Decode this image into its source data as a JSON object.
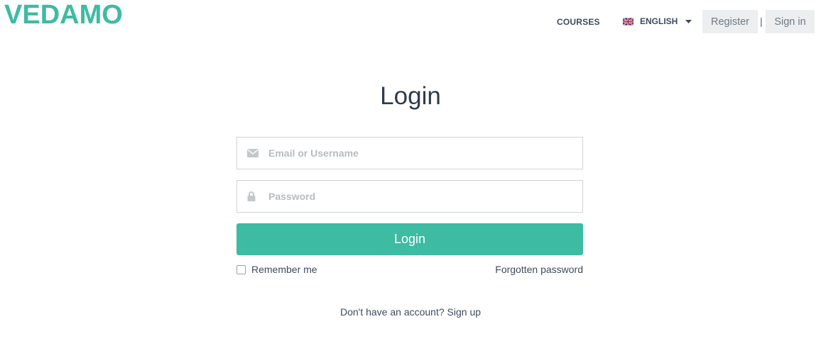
{
  "brand": {
    "name": "VEDAMO",
    "color": "#3dbba3",
    "accent_dark": "#1c8f6e"
  },
  "header": {
    "courses_label": "COURSES",
    "language": {
      "label": "ENGLISH",
      "flag_icon": "uk-flag-icon",
      "caret_icon": "caret-down-icon"
    },
    "register_label": "Register",
    "separator": "|",
    "signin_label": "Sign in"
  },
  "login": {
    "title": "Login",
    "email": {
      "placeholder": "Email or Username",
      "value": "",
      "icon": "envelope-icon"
    },
    "password": {
      "placeholder": "Password",
      "value": "",
      "icon": "lock-icon"
    },
    "submit_label": "Login",
    "remember_label": "Remember me",
    "remember_checked": false,
    "forgot_label": "Forgotten password",
    "no_account_text": "Don't have an account?",
    "signup_label": "Sign up"
  },
  "colors": {
    "primary_button": "#3dbba3",
    "text": "#2f3b4a",
    "top_button_bg": "#eceeef"
  }
}
